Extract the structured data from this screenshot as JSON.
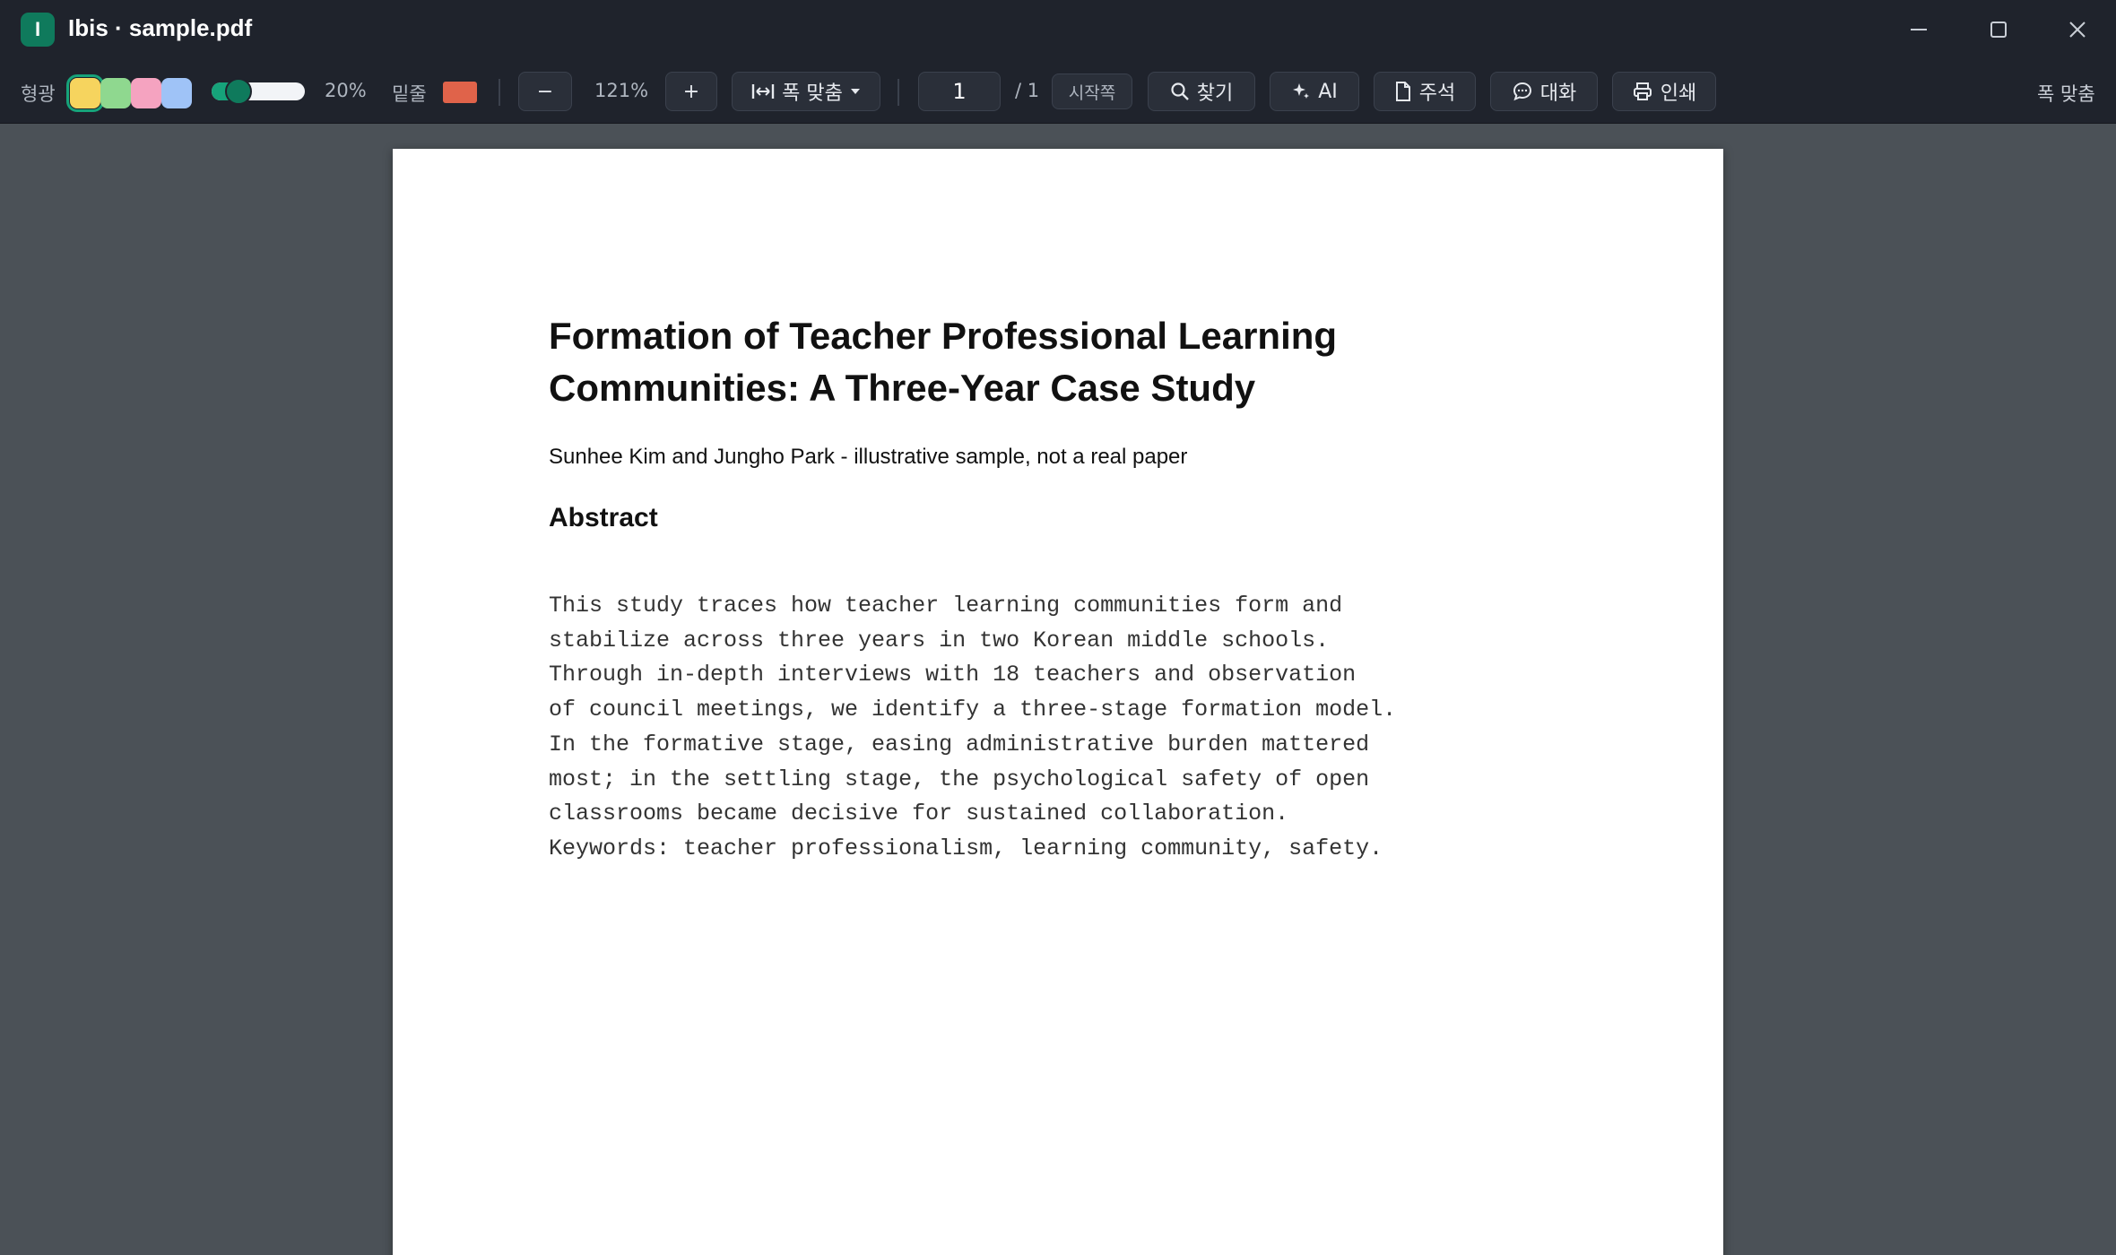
{
  "window": {
    "logo_letter": "I",
    "title": "Ibis · sample.pdf"
  },
  "toolbar": {
    "highlight_label": "형광",
    "highlight_colors": [
      "#f6d45e",
      "#8fd88f",
      "#f5a3c0",
      "#9fc3f7"
    ],
    "selected_color_index": 0,
    "opacity_value": "20%",
    "opacity_fraction": 0.2,
    "underline_label": "밑줄",
    "underline_color": "#e0634a",
    "zoom_out_label": "−",
    "zoom_level": "121%",
    "zoom_in_label": "+",
    "fit_width_label": "폭 맞춤",
    "page_current": "1",
    "page_total": "/ 1",
    "first_page_label": "시작쪽",
    "find_label": "찾기",
    "ai_label": "AI",
    "annotations_label": "주석",
    "chat_label": "대화",
    "print_label": "인쇄",
    "right_fit_label": "폭 맞춤"
  },
  "document": {
    "title_line1": "Formation of Teacher Professional Learning",
    "title_line2": "Communities: A Three-Year Case Study",
    "authors": "Sunhee Kim and Jungho Park - illustrative sample, not a real paper",
    "abstract_heading": "Abstract",
    "abstract_lines": [
      "This study traces how teacher learning communities form and",
      "stabilize across three years in two Korean middle schools.",
      "Through in-depth interviews with 18 teachers and observation",
      "of council meetings, we identify a three-stage formation model.",
      "In the formative stage, easing administrative burden mattered",
      "most; in the settling stage, the psychological safety of open",
      "classrooms became decisive for sustained collaboration.",
      "Keywords: teacher professionalism, learning community, safety."
    ]
  },
  "colors": {
    "accent": "#16a37a",
    "titlebar_bg": "#1f232c",
    "viewer_bg": "#4b5157"
  }
}
